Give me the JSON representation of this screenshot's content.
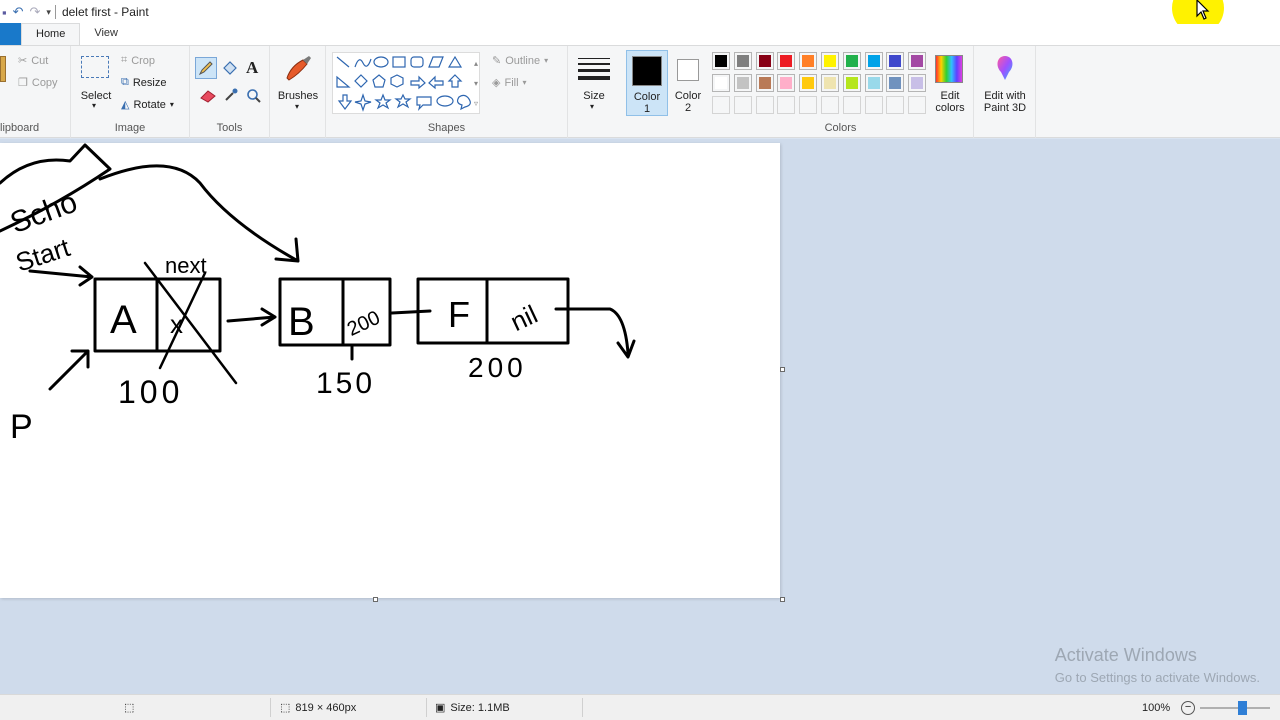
{
  "window": {
    "title": "delet first - Paint"
  },
  "tabs": [
    {
      "label": "Home"
    },
    {
      "label": "View"
    }
  ],
  "clipboard": {
    "cut": "Cut",
    "copy": "Copy",
    "group_label": "lipboard"
  },
  "image": {
    "select": "Select",
    "crop": "Crop",
    "resize": "Resize",
    "rotate": "Rotate",
    "group_label": "Image"
  },
  "tools": {
    "group_label": "Tools",
    "text_tool_glyph": "A"
  },
  "brushes": {
    "label": "Brushes"
  },
  "shapes": {
    "outline": "Outline",
    "fill": "Fill",
    "group_label": "Shapes"
  },
  "size": {
    "label": "Size"
  },
  "color1": {
    "label_line1": "Color",
    "label_line2": "1",
    "value": "#000000"
  },
  "color2": {
    "label_line1": "Color",
    "label_line2": "2",
    "value": "#ffffff"
  },
  "colors": {
    "group_label": "Colors",
    "palette_row1": [
      "#000000",
      "#7f7f7f",
      "#880015",
      "#ed1c24",
      "#ff7f27",
      "#fff200",
      "#22b14c",
      "#00a2e8",
      "#3f48cc",
      "#a349a4"
    ],
    "palette_row2": [
      "#ffffff",
      "#c3c3c3",
      "#b97a57",
      "#ffaec9",
      "#ffc90e",
      "#efe4b0",
      "#b5e61d",
      "#99d9ea",
      "#7092be",
      "#c8bfe7"
    ],
    "edit_colors_line1": "Edit",
    "edit_colors_line2": "colors"
  },
  "paint3d": {
    "line1": "Edit with",
    "line2": "Paint 3D"
  },
  "drawing": {
    "node1_value": "A",
    "node1_addr": "100",
    "node2_value": "B",
    "node2_next": "200",
    "node2_addr": "150",
    "node3_value": "F",
    "node3_next": "nil",
    "node3_addr": "200",
    "top_label": "Scho",
    "start_label": "Start",
    "next_label": "next",
    "p_label": "P"
  },
  "watermark": {
    "line1": "Activate Windows",
    "line2": "Go to Settings to activate Windows."
  },
  "status": {
    "dimensions": "819 × 460px",
    "size": "Size: 1.1MB",
    "zoom": "100%"
  }
}
